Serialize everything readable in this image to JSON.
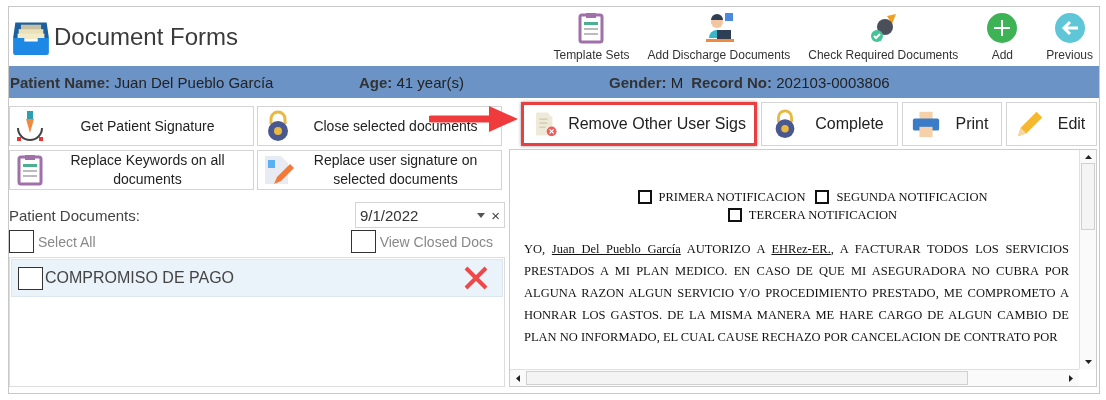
{
  "app": {
    "title": "Document Forms"
  },
  "toolbar": [
    {
      "label": "Template Sets",
      "kind": "clipboard"
    },
    {
      "label": "Add Discharge Documents",
      "kind": "person"
    },
    {
      "label": "Check Required Documents",
      "kind": "brush"
    },
    {
      "label": "Add",
      "kind": "add"
    },
    {
      "label": "Previous",
      "kind": "back"
    }
  ],
  "patient_bar": [
    {
      "label": "Patient Name:",
      "value": "Juan Del Pueblo García"
    },
    {
      "label": "Age:",
      "value": "41 year(s)"
    },
    {
      "label": "Gender:",
      "value": "M"
    },
    {
      "label": "Record No:",
      "value": "202103-0003806"
    }
  ],
  "actions": [
    {
      "label": "Get Patient Signature",
      "kind": "pen"
    },
    {
      "label": "Close selected documents",
      "kind": "lock"
    },
    {
      "label": "Replace Keywords on all documents",
      "kind": "clipboard"
    },
    {
      "label": "Replace user signature on selected documents",
      "kind": "edit-doc"
    }
  ],
  "documents_label": "Patient Documents:",
  "date_filter": {
    "value": "9/1/2022",
    "clear": "×"
  },
  "select_all": {
    "label": "Select All",
    "checked": false
  },
  "view_closed": {
    "label": "View Closed Docs",
    "checked": false
  },
  "documents": [
    {
      "name": "COMPROMISO DE PAGO",
      "checked": false,
      "selected": true
    }
  ],
  "document_actions": [
    {
      "label": "Remove Other User Sigs",
      "kind": "remove",
      "highlighted": true
    },
    {
      "label": "Complete",
      "kind": "lock",
      "highlighted": false
    },
    {
      "label": "Print",
      "kind": "print",
      "highlighted": false
    },
    {
      "label": "Edit",
      "kind": "pencil",
      "highlighted": false
    }
  ],
  "document": {
    "notices": [
      {
        "label": "PRIMERA NOTIFICACION",
        "checked": false
      },
      {
        "label": "SEGUNDA NOTIFICACION",
        "checked": false
      },
      {
        "label": "TERCERA NOTIFICACION",
        "checked": false
      }
    ],
    "paragraph": [
      {
        "text": "YO, ",
        "underlined": false
      },
      {
        "text": "Juan Del Pueblo García",
        "underlined": true
      },
      {
        "text": "  AUTORIZO A ",
        "underlined": false
      },
      {
        "text": "EHRez-ER.",
        "underlined": true
      },
      {
        "text": ",  A FACTURAR TODOS LOS SERVICIOS PRESTADOS A MI PLAN MEDICO.  EN CASO DE QUE MI ASEGURADORA NO CUBRA POR ALGUNA RAZON ALGUN SERVICIO Y/O PROCEDIMIENTO PRESTADO, ME COMPROMETO A HONRAR LOS GASTOS.  DE LA MISMA MANERA ME HARE CARGO DE ALGUN CAMBIO DE PLAN NO INFORMADO, EL CUAL CAUSE RECHAZO POR CANCELACION DE CONTRATO POR",
        "underlined": false
      }
    ]
  }
}
